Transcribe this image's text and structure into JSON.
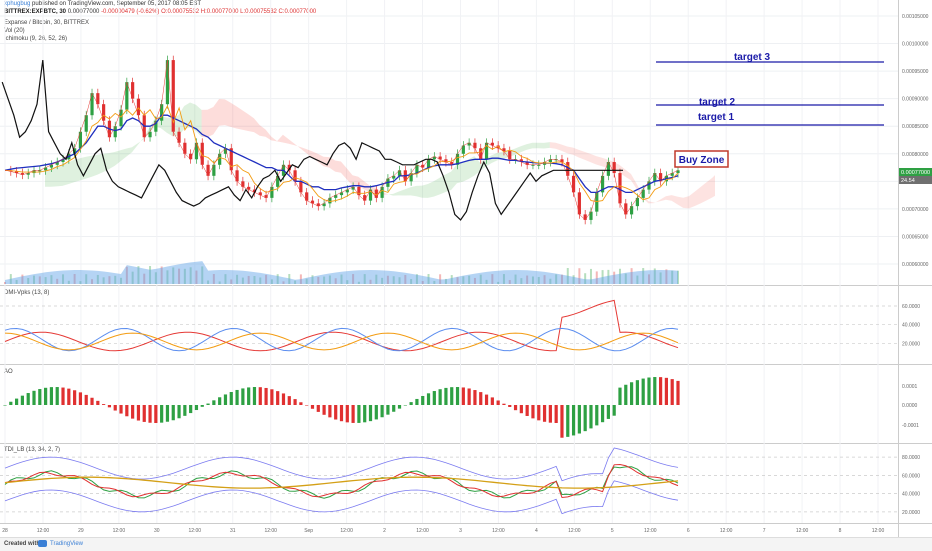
{
  "header": {
    "user": "xphugbug",
    "published": "published on TradingView.com, September 05, 2017 08:05 EST",
    "symbol": "BITTREX:EXPBTC, 30",
    "last": "0.00077000",
    "change": "-0.00000479 (-0.62%)",
    "ohlc": "O:0.00075532 H:0.00077000 L:0.00075532 C:0.00077000"
  },
  "legend": {
    "main": "Expanse / Bitcoin, 30, BITTREX",
    "vol": "Vol (20)",
    "ichimoku": "Ichimoku (9, 26, 52, 26)",
    "dmi": "DMI-Vpks (13, 8)",
    "ao": "AO",
    "tdi": "TDI_LB (13, 34, 2, 7)"
  },
  "annotations": {
    "target3": "target 3",
    "target2": "target 2",
    "target1": "target 1",
    "buy_zone": "Buy Zone"
  },
  "price_axis": [
    "0.00105000",
    "0.00100000",
    "0.00095000",
    "0.00090000",
    "0.00085000",
    "0.00080000",
    "0.00075000",
    "0.00070000",
    "0.00065000",
    "0.00060000"
  ],
  "price_tags": [
    "0.00077000",
    "24.54"
  ],
  "dmi_axis": [
    "60.0000",
    "40.0000",
    "20.0000"
  ],
  "ao_axis": [
    "0.0001",
    "0.0000",
    "-0.0001"
  ],
  "tdi_axis": [
    "80.0000",
    "60.0000",
    "40.0000",
    "20.0000"
  ],
  "time_axis": [
    "28",
    "12:00",
    "29",
    "12:00",
    "30",
    "12:00",
    "31",
    "12:00",
    "Sep",
    "12:00",
    "2",
    "12:00",
    "3",
    "12:00",
    "4",
    "12:00",
    "5",
    "12:00",
    "6",
    "12:00",
    "7",
    "12:00",
    "8",
    "12:00"
  ],
  "footer": {
    "created": "Created with",
    "brand": "TradingView"
  },
  "colors": {
    "target": "#1a1aa8",
    "buy_zone": "#c0392b",
    "up": "#2ea043",
    "down": "#e03030",
    "kijun": "#1f2fbf"
  },
  "chart_data": {
    "type": "line",
    "title": "Expanse / Bitcoin, 30, BITTREX",
    "ylim": [
      0.0006,
      0.00105
    ],
    "close": [
      0.00077,
      0.000768,
      0.000765,
      0.000762,
      0.000765,
      0.00077,
      0.00077,
      0.000775,
      0.00078,
      0.000785,
      0.00079,
      0.0008,
      0.00081,
      0.00084,
      0.00087,
      0.00091,
      0.00089,
      0.00086,
      0.00083,
      0.00085,
      0.00088,
      0.00093,
      0.0009,
      0.00087,
      0.00083,
      0.00084,
      0.00086,
      0.00089,
      0.00097,
      0.00084,
      0.00082,
      0.0008,
      0.00079,
      0.00082,
      0.00078,
      0.00076,
      0.00078,
      0.0008,
      0.00081,
      0.00077,
      0.00075,
      0.00074,
      0.000735,
      0.00073,
      0.000725,
      0.00072,
      0.00074,
      0.00076,
      0.00078,
      0.00077,
      0.00075,
      0.00073,
      0.000715,
      0.00071,
      0.000705,
      0.00071,
      0.00072,
      0.000725,
      0.00073,
      0.000735,
      0.00074,
      0.000725,
      0.000715,
      0.000735,
      0.00072,
      0.00074,
      0.000755,
      0.00076,
      0.00077,
      0.00075,
      0.000765,
      0.00078,
      0.000775,
      0.00079,
      0.000795,
      0.00079,
      0.000785,
      0.00078,
      0.0008,
      0.000815,
      0.00082,
      0.00081,
      0.00079,
      0.00082,
      0.000815,
      0.00081,
      0.000805,
      0.00079,
      0.00079,
      0.000785,
      0.00078,
      0.00078,
      0.00078,
      0.000785,
      0.00079,
      0.00079,
      0.000785,
      0.00076,
      0.00073,
      0.00069,
      0.00068,
      0.000695,
      0.00073,
      0.00076,
      0.000785,
      0.000765,
      0.00071,
      0.00069,
      0.000705,
      0.00072,
      0.000735,
      0.00075,
      0.000765,
      0.00075,
      0.00076,
      0.000765,
      0.00077
    ],
    "kijun": [
      0.00077,
      0.000772,
      0.000774,
      0.000775,
      0.000776,
      0.000777,
      0.000778,
      0.00078,
      0.000782,
      0.000785,
      0.00079,
      0.000795,
      0.0008,
      0.00081,
      0.00082,
      0.000835,
      0.00085,
      0.00085,
      0.000845,
      0.000842,
      0.000845,
      0.00086,
      0.000865,
      0.00086,
      0.00085,
      0.00085,
      0.000855,
      0.00087,
      0.00087,
      0.000865,
      0.00086,
      0.000855,
      0.00085,
      0.000845,
      0.000835,
      0.00083,
      0.00082,
      0.000815,
      0.00081,
      0.000805,
      0.0008,
      0.000795,
      0.00079,
      0.000785,
      0.00078,
      0.000775,
      0.000775,
      0.00077,
      0.00077,
      0.00076,
      0.00075,
      0.00075,
      0.000745,
      0.00074,
      0.00074,
      0.000735,
      0.000735,
      0.000735,
      0.000738,
      0.00074,
      0.000742,
      0.000742,
      0.00074,
      0.00074,
      0.000742,
      0.000745,
      0.000748,
      0.00075,
      0.00076,
      0.00076,
      0.000762,
      0.000765,
      0.00077,
      0.000775,
      0.000778,
      0.00078,
      0.00078,
      0.00078,
      0.000782,
      0.000785,
      0.000788,
      0.00079,
      0.00079,
      0.00079,
      0.000792,
      0.000792,
      0.00079,
      0.000788,
      0.000788,
      0.000786,
      0.000785,
      0.000784,
      0.000783,
      0.000783,
      0.000783,
      0.000782,
      0.00078,
      0.000775,
      0.00077,
      0.000755,
      0.00074,
      0.00073,
      0.00073,
      0.000735,
      0.00074,
      0.00074,
      0.000735,
      0.00073,
      0.00073,
      0.000735,
      0.00074,
      0.000745,
      0.00075,
      0.000752,
      0.000755,
      0.000757,
      0.00076
    ]
  }
}
